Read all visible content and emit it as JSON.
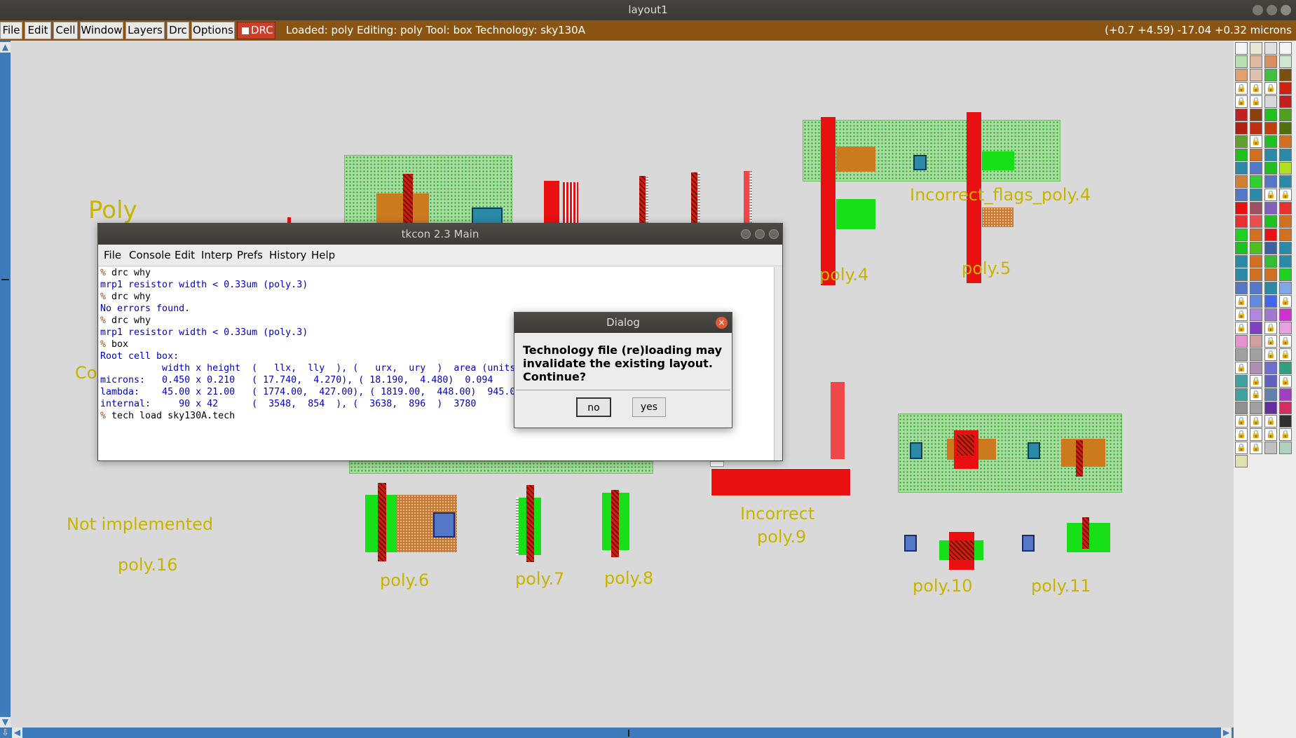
{
  "window": {
    "title": "layout1"
  },
  "menubar": {
    "items": [
      "File",
      "Edit",
      "Cell",
      "Window",
      "Layers",
      "Drc",
      "Options"
    ],
    "drc_toggle": "DRC",
    "status": "Loaded: poly Editing: poly Tool: box  Technology: sky130A",
    "coords": "(+0.7 +4.59) -17.04 +0.32 microns"
  },
  "canvas": {
    "labels": {
      "poly": "Poly",
      "co": "Co",
      "incorrect_flags": "Incorrect_flags_poly.4",
      "not_implemented": "Not implemented",
      "poly16": "poly.16",
      "poly4": "poly.4",
      "poly5": "poly.5",
      "poly6": "poly.6",
      "poly7": "poly.7",
      "poly8": "poly.8",
      "incorrect": "Incorrect",
      "poly9": "poly.9",
      "poly10": "poly.10",
      "poly11": "poly.11"
    }
  },
  "tkcon": {
    "title": "tkcon 2.3 Main",
    "menu": [
      "File",
      "Console",
      "Edit",
      "Interp",
      "Prefs",
      "History",
      "Help"
    ],
    "console_lines": [
      {
        "type": "cmd",
        "prompt": "% ",
        "text": "drc why"
      },
      {
        "type": "out",
        "text": "mrp1 resistor width < 0.33um (poly.3)"
      },
      {
        "type": "cmd",
        "prompt": "% ",
        "text": "drc why"
      },
      {
        "type": "out",
        "text": "No errors found."
      },
      {
        "type": "cmd",
        "prompt": "% ",
        "text": "drc why"
      },
      {
        "type": "out",
        "text": "mrp1 resistor width < 0.33um (poly.3)"
      },
      {
        "type": "cmd",
        "prompt": "% ",
        "text": "box"
      },
      {
        "type": "out",
        "text": "Root cell box:"
      },
      {
        "type": "out",
        "text": "           width x height  (   llx,  lly  ), (   urx,  ury  )  area (units^2)"
      },
      {
        "type": "out",
        "text": ""
      },
      {
        "type": "out",
        "text": "microns:   0.450 x 0.210   ( 17.740,  4.270), ( 18.190,  4.480)  0.094"
      },
      {
        "type": "out",
        "text": "lambda:    45.00 x 21.00   ( 1774.00,  427.00), ( 1819.00,  448.00)  945.00"
      },
      {
        "type": "out",
        "text": "internal:     90 x 42      (  3548,  854  ), (  3638,  896  )  3780"
      },
      {
        "type": "cmd",
        "prompt": "% ",
        "text": "tech load sky130A.tech"
      }
    ]
  },
  "dialog": {
    "title": "Dialog",
    "close": "×",
    "message": "Technology file (re)loading may invalidate the existing layout. Continue?",
    "no": "no",
    "yes": "yes"
  }
}
